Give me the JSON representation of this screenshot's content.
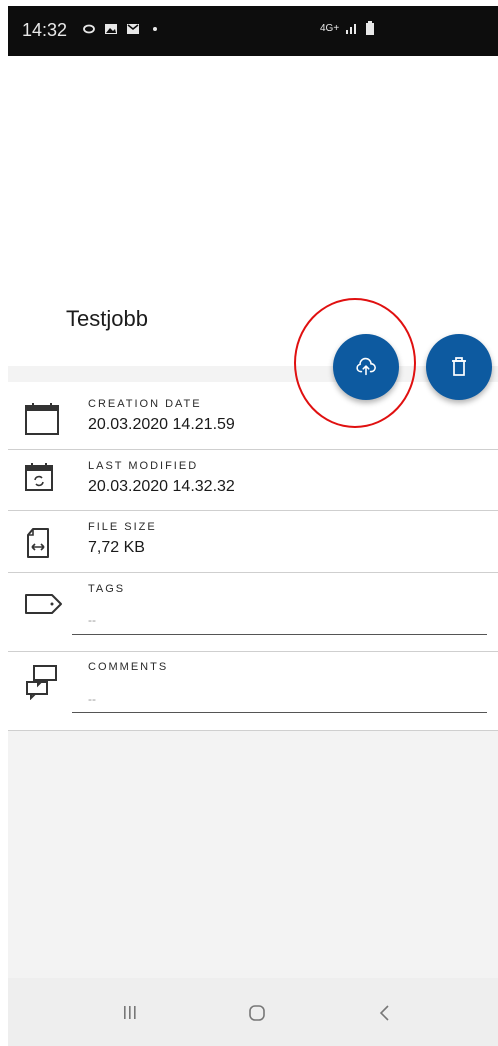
{
  "status_bar": {
    "time": "14:32",
    "network": "4G+",
    "icons": [
      "sync-icon",
      "image-icon",
      "mail-icon",
      "dot-icon"
    ]
  },
  "job": {
    "title": "Testjobb"
  },
  "actions": {
    "upload_icon": "cloud-upload-icon",
    "delete_icon": "trash-icon"
  },
  "details": {
    "creation": {
      "label": "CREATION DATE",
      "value": "20.03.2020 14.21.59"
    },
    "modified": {
      "label": "LAST MODIFIED",
      "value": "20.03.2020 14.32.32"
    },
    "size": {
      "label": "FILE SIZE",
      "value": "7,72 KB"
    },
    "tags": {
      "label": "TAGS",
      "value": "--"
    },
    "comments": {
      "label": "COMMENTS",
      "value": "--"
    }
  },
  "colors": {
    "accent": "#0d5aa0",
    "highlight": "#e01010"
  }
}
